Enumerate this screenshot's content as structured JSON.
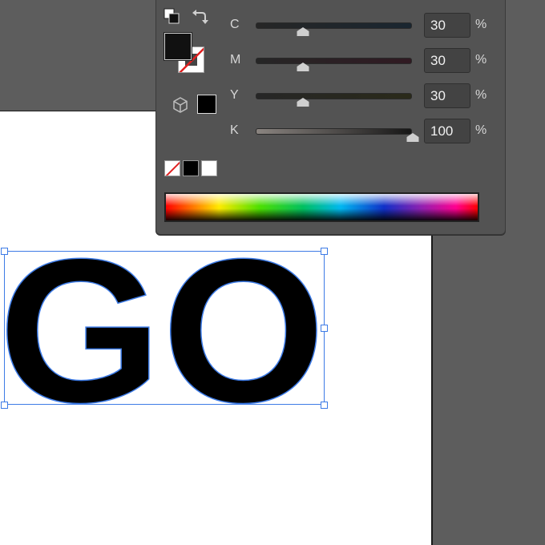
{
  "panel": {
    "sliders": [
      {
        "label": "C",
        "value": "30",
        "unit": "%",
        "fraction": 0.3
      },
      {
        "label": "M",
        "value": "30",
        "unit": "%",
        "fraction": 0.3
      },
      {
        "label": "Y",
        "value": "30",
        "unit": "%",
        "fraction": 0.3
      },
      {
        "label": "K",
        "value": "100",
        "unit": "%",
        "fraction": 1.0
      }
    ],
    "fill_color": "#111111",
    "stroke": "none",
    "quick_swatches": [
      "none",
      "#000000",
      "#ffffff"
    ]
  },
  "canvas": {
    "text": "GO",
    "text_color": "#000000",
    "selection_color": "#3d7be6"
  }
}
